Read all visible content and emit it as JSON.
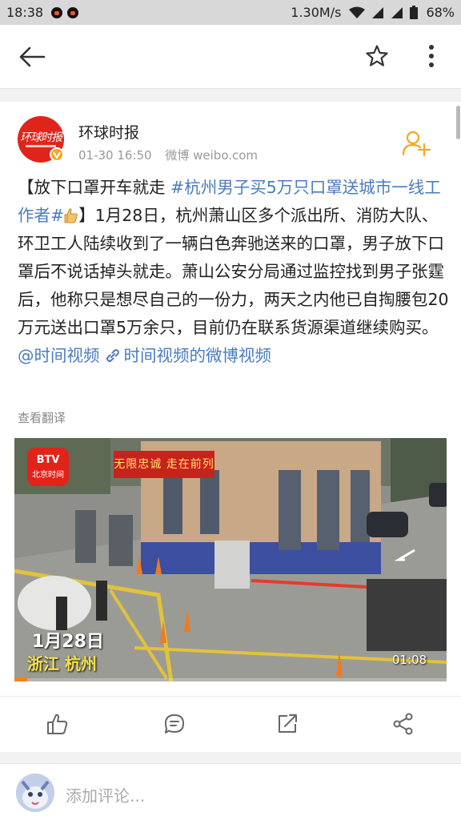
{
  "status_bar": {
    "time": "18:38",
    "network_speed": "1.30M/s",
    "battery": "68%",
    "icons": [
      "qq-icon",
      "qq-icon",
      "wifi-icon",
      "signal-icon",
      "signal-icon",
      "battery-icon"
    ]
  },
  "header": {
    "icons": [
      "back-arrow-icon",
      "star-icon",
      "more-vertical-icon"
    ]
  },
  "post": {
    "author": "环球时报",
    "avatar_text": "环球时报",
    "time": "01-30 16:50",
    "source": "微博 weibo.com",
    "text_intro": "【放下口罩开车就走 ",
    "hashtag": "#杭州男子买5万只口罩送城市一线工作者#",
    "text_mid": "】1月28日，杭州萧山区多个派出所、消防大队、环卫工人陆续收到了一辆白色奔驰送来的口罩，男子放下口罩后不说话掉头就走。萧山公安分局通过监控找到男子张霆后，他称只是想尽自己的一份力，两天之内他已自掏腰包20万元送出口罩5万余只，目前仍在联系货源渠道继续购买。",
    "mention": "@时间视频",
    "link_text": "时间视频的微博视频",
    "translate": "查看翻译"
  },
  "video": {
    "channel_logo_top": "BTV",
    "channel_logo_bottom": "北京时间",
    "banner": "无限忠诚 走在前列",
    "date_caption": "1月28日",
    "place_caption": "浙江 杭州",
    "duration": "01:08",
    "progress": 0.03
  },
  "actions": [
    "like-icon",
    "comment-icon",
    "repost-icon",
    "share-icon"
  ],
  "comment_bar": {
    "placeholder": "添加评论..."
  },
  "colors": {
    "link": "#4a7bc0",
    "brand_red": "#e0241b",
    "verified_badge": "#f6a623",
    "follow_icon": "#f5a623"
  }
}
